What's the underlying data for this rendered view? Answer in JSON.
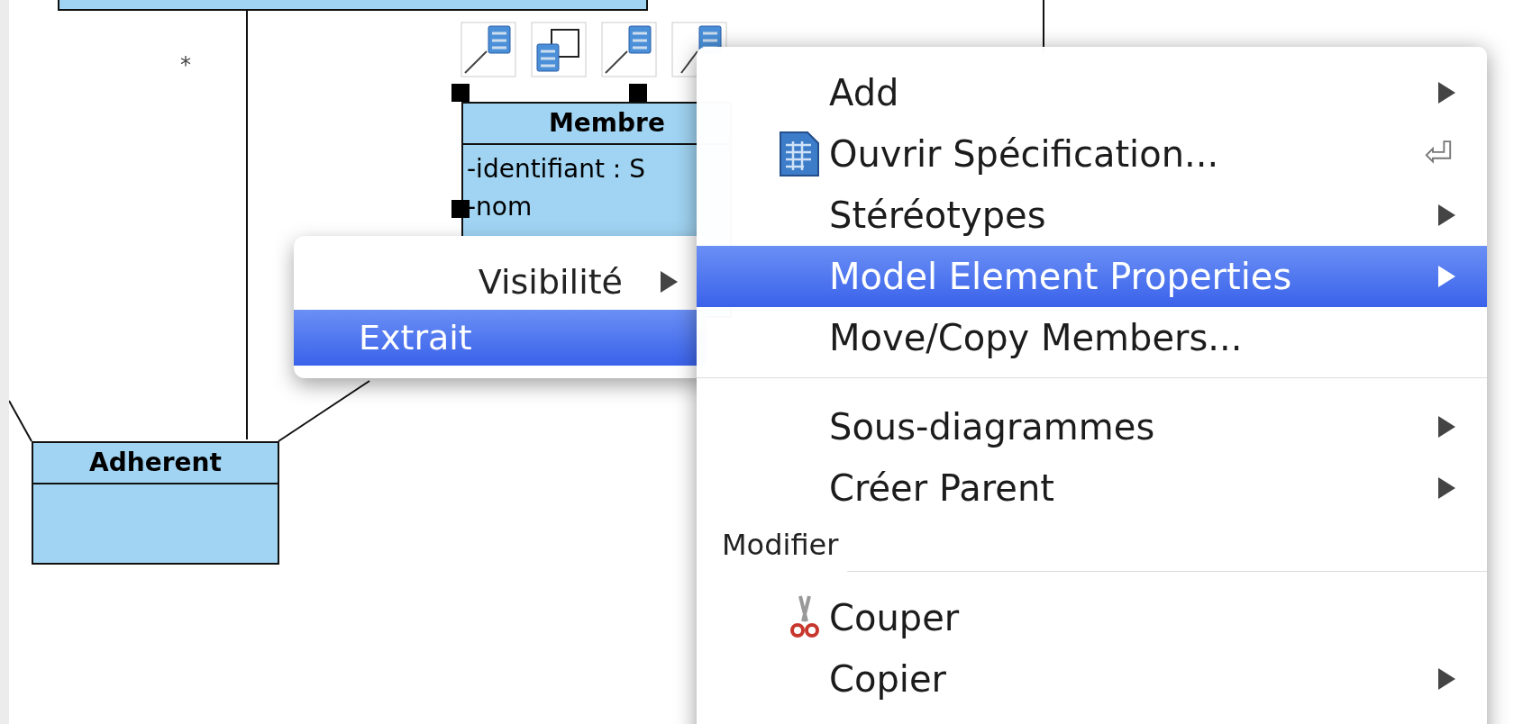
{
  "diagram": {
    "multiplicities": [
      "*"
    ],
    "classes": [
      {
        "name": "Membre",
        "attributes": [
          "-identifiant : S",
          "-nom"
        ],
        "selected": true
      },
      {
        "name": "Adherent",
        "selected": false
      }
    ]
  },
  "submenu": {
    "items": [
      {
        "label": "Visibilité",
        "submenu": true,
        "selected": false
      },
      {
        "label": "Extrait",
        "submenu": false,
        "selected": true
      }
    ]
  },
  "context_menu": {
    "items": [
      {
        "kind": "item",
        "label": "Add",
        "submenu": true,
        "selected": false
      },
      {
        "kind": "item",
        "label": "Ouvrir Spécification...",
        "shortcut": "⏎",
        "submenu": false,
        "selected": false
      },
      {
        "kind": "item",
        "label": "Stéréotypes",
        "submenu": true,
        "selected": false
      },
      {
        "kind": "item",
        "label": "Model Element Properties",
        "submenu": true,
        "selected": true
      },
      {
        "kind": "item",
        "label": "Move/Copy Members...",
        "submenu": false,
        "selected": false
      },
      {
        "kind": "separator"
      },
      {
        "kind": "item",
        "label": "Sous-diagrammes",
        "submenu": true,
        "selected": false
      },
      {
        "kind": "item",
        "label": "Créer Parent",
        "submenu": true,
        "selected": false
      },
      {
        "kind": "header",
        "label": "Modifier"
      },
      {
        "kind": "item",
        "label": "Couper",
        "submenu": false,
        "selected": false
      },
      {
        "kind": "item",
        "label": "Copier",
        "submenu": true,
        "selected": false
      }
    ]
  }
}
